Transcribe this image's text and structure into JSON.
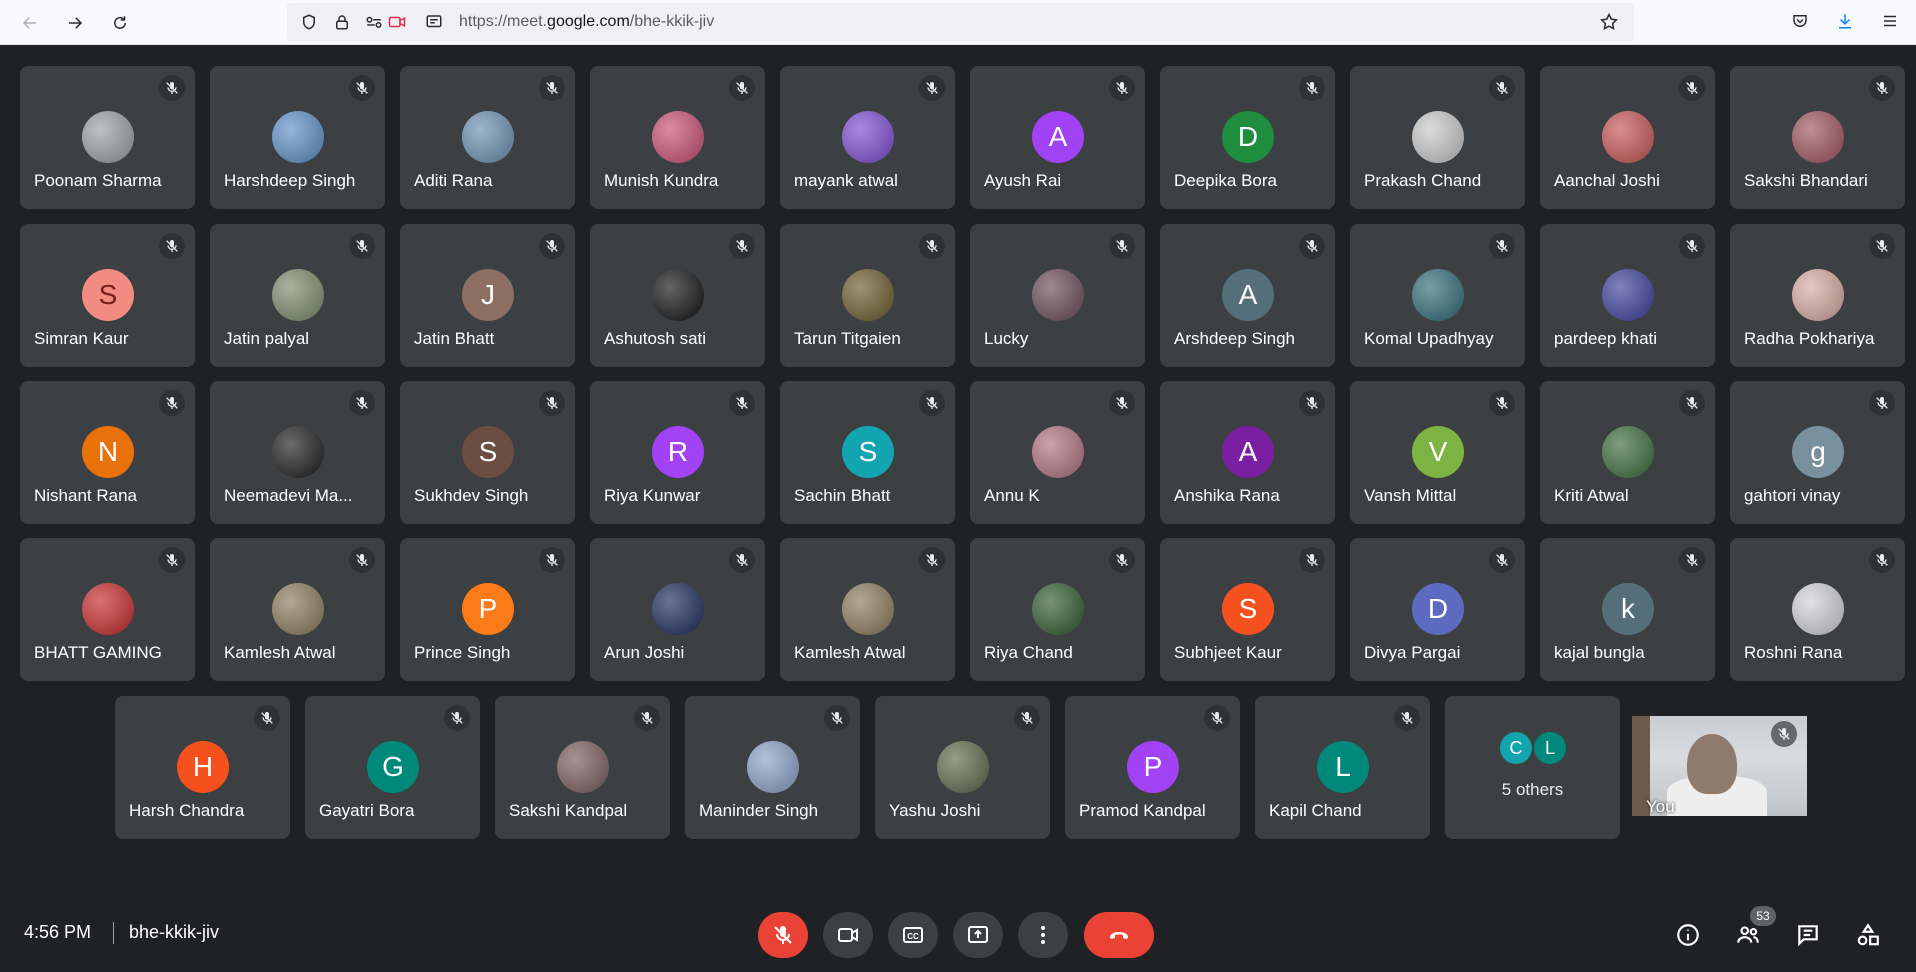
{
  "browser": {
    "url_prefix": "https://meet.",
    "url_domain": "google.com",
    "url_path": "/bhe-kkik-jiv"
  },
  "meeting": {
    "time": "4:56 PM",
    "code": "bhe-kkik-jiv",
    "participants_count": "53"
  },
  "rows": [
    [
      {
        "name": "Poonam Sharma",
        "avatar": "photo",
        "color": "#9aa0a6"
      },
      {
        "name": "Harshdeep Singh",
        "avatar": "photo",
        "color": "#5b8fc7"
      },
      {
        "name": "Aditi Rana",
        "avatar": "photo",
        "color": "#6a8fb0"
      },
      {
        "name": "Munish Kundra",
        "avatar": "photo",
        "color": "#c94d74"
      },
      {
        "name": "mayank atwal",
        "avatar": "photo",
        "color": "#7c4bd1"
      },
      {
        "name": "Ayush Rai",
        "avatar": "A",
        "color": "#a142f4"
      },
      {
        "name": "Deepika Bora",
        "avatar": "D",
        "color": "#1e8e3e"
      },
      {
        "name": "Prakash Chand",
        "avatar": "photo",
        "color": "#c8c8c8"
      },
      {
        "name": "Aanchal Joshi",
        "avatar": "photo",
        "color": "#c75454"
      },
      {
        "name": "Sakshi Bhandari",
        "avatar": "photo",
        "color": "#a0525c"
      }
    ],
    [
      {
        "name": "Simran Kaur",
        "avatar": "S",
        "color": "#f28b82",
        "dark_letter": true
      },
      {
        "name": "Jatin palyal",
        "avatar": "photo",
        "color": "#7a8b6a"
      },
      {
        "name": "Jatin Bhatt",
        "avatar": "J",
        "color": "#8d6e63"
      },
      {
        "name": "Ashutosh sati",
        "avatar": "photo",
        "color": "#111111"
      },
      {
        "name": "Tarun Titgaien",
        "avatar": "photo",
        "color": "#6b5a2a"
      },
      {
        "name": "Lucky",
        "avatar": "photo",
        "color": "#6a4a55"
      },
      {
        "name": "Arshdeep Singh",
        "avatar": "A",
        "color": "#546e7a"
      },
      {
        "name": "Komal Upadhyay",
        "avatar": "photo",
        "color": "#2f6b78"
      },
      {
        "name": "pardeep khati",
        "avatar": "photo",
        "color": "#3a3f9a"
      },
      {
        "name": "Radha Pokhariya",
        "avatar": "photo",
        "color": "#d8a9a0"
      }
    ],
    [
      {
        "name": "Nishant Rana",
        "avatar": "N",
        "color": "#e8710a"
      },
      {
        "name": "Neemadevi Ma...",
        "avatar": "photo",
        "color": "#1b1b1b"
      },
      {
        "name": "Sukhdev Singh",
        "avatar": "S",
        "color": "#6d4c41"
      },
      {
        "name": "Riya Kunwar",
        "avatar": "R",
        "color": "#a142f4"
      },
      {
        "name": "Sachin Bhatt",
        "avatar": "S",
        "color": "#12a4af"
      },
      {
        "name": "Annu K",
        "avatar": "photo",
        "color": "#b07080"
      },
      {
        "name": "Anshika Rana",
        "avatar": "A",
        "color": "#7b1fa2"
      },
      {
        "name": "Vansh Mittal",
        "avatar": "V",
        "color": "#7cb342"
      },
      {
        "name": "Kriti Atwal",
        "avatar": "photo",
        "color": "#3a6b3a"
      },
      {
        "name": "gahtori vinay",
        "avatar": "g",
        "color": "#78909c"
      }
    ],
    [
      {
        "name": "BHATT GAMING",
        "avatar": "photo",
        "color": "#c62828"
      },
      {
        "name": "Kamlesh Atwal",
        "avatar": "photo",
        "color": "#8a7a5a"
      },
      {
        "name": "Prince Singh",
        "avatar": "P",
        "color": "#fa7b17"
      },
      {
        "name": "Arun Joshi",
        "avatar": "photo",
        "color": "#1a2a5a"
      },
      {
        "name": "Kamlesh Atwal",
        "avatar": "photo",
        "color": "#8a7a5a"
      },
      {
        "name": "Riya Chand",
        "avatar": "photo",
        "color": "#2e5a2e"
      },
      {
        "name": "Subhjeet Kaur",
        "avatar": "S",
        "color": "#f4511e"
      },
      {
        "name": "Divya Pargai",
        "avatar": "D",
        "color": "#5c6bc0"
      },
      {
        "name": "kajal bungla",
        "avatar": "k",
        "color": "#546e7a"
      },
      {
        "name": "Roshni Rana",
        "avatar": "photo",
        "color": "#d0d0d8"
      }
    ],
    [
      {
        "name": "Harsh Chandra",
        "avatar": "H",
        "color": "#f4511e"
      },
      {
        "name": "Gayatri Bora",
        "avatar": "G",
        "color": "#00897b"
      },
      {
        "name": "Sakshi Kandpal",
        "avatar": "photo",
        "color": "#7a5a5a"
      },
      {
        "name": "Maninder Singh",
        "avatar": "photo",
        "color": "#8aa0c8"
      },
      {
        "name": "Yashu Joshi",
        "avatar": "photo",
        "color": "#5a6a4a"
      },
      {
        "name": "Pramod Kandpal",
        "avatar": "P",
        "color": "#a142f4"
      },
      {
        "name": "Kapil Chand",
        "avatar": "L",
        "color": "#00897b"
      }
    ]
  ],
  "others": {
    "label": "5 others",
    "avatars": [
      {
        "letter": "C",
        "color": "#12a4af"
      },
      {
        "letter": "L",
        "color": "#00897b"
      }
    ]
  },
  "self_tile": {
    "name": "You"
  }
}
